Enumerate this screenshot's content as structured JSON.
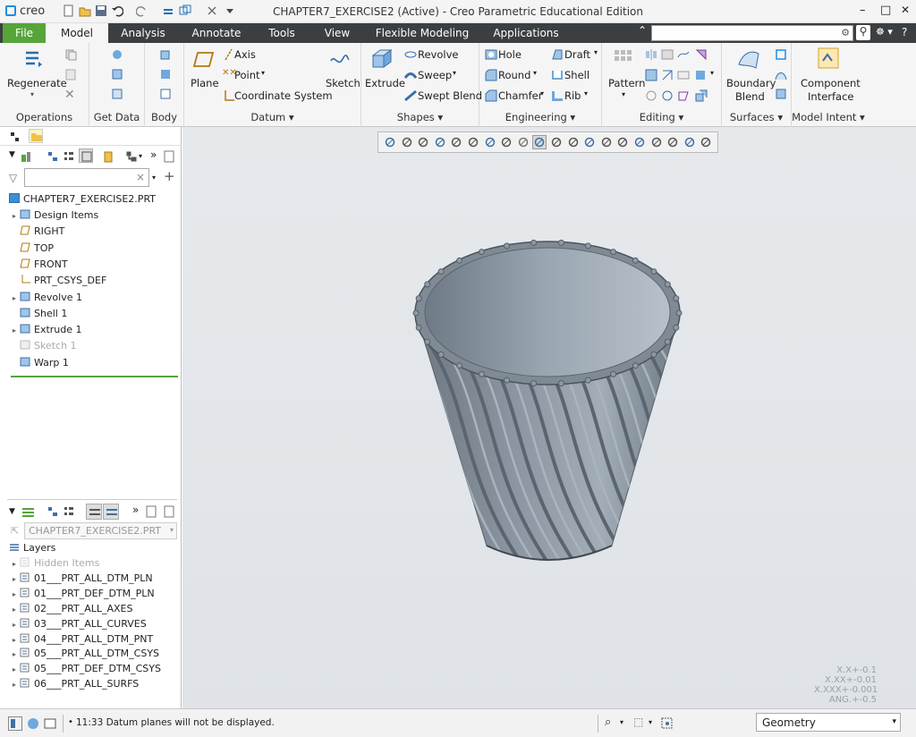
{
  "window": {
    "title": "CHAPTER7_EXERCISE2 (Active) - Creo Parametric Educational Edition",
    "logo": "creo",
    "controls": [
      "–",
      "□",
      "✕"
    ]
  },
  "tabs": [
    "File",
    "Model",
    "Analysis",
    "Annotate",
    "Tools",
    "View",
    "Flexible Modeling",
    "Applications"
  ],
  "active_tab": "Model",
  "ribbon": {
    "operations": {
      "regenerate": "Regenerate",
      "label": "Operations"
    },
    "get_data": {
      "label": "Get Data"
    },
    "body": {
      "label": "Body"
    },
    "datum": {
      "plane": "Plane",
      "axis": "Axis",
      "point": "Point",
      "csys": "Coordinate System",
      "sketch": "Sketch",
      "label": "Datum"
    },
    "shapes": {
      "extrude": "Extrude",
      "revolve": "Revolve",
      "sweep": "Sweep",
      "swept_blend": "Swept Blend",
      "label": "Shapes"
    },
    "engineering": {
      "hole": "Hole",
      "draft": "Draft",
      "round": "Round",
      "shell": "Shell",
      "chamfer": "Chamfer",
      "rib": "Rib",
      "label": "Engineering"
    },
    "editing": {
      "pattern": "Pattern",
      "label": "Editing"
    },
    "surfaces": {
      "boundary1": "Boundary",
      "boundary2": "Blend",
      "label": "Surfaces"
    },
    "model_intent": {
      "ci1": "Component",
      "ci2": "Interface",
      "label": "Model Intent"
    }
  },
  "model_tree": {
    "root": "CHAPTER7_EXERCISE2.PRT",
    "items": [
      {
        "label": "Design Items",
        "expandable": true,
        "disabled": false
      },
      {
        "label": "RIGHT",
        "expandable": false,
        "disabled": false
      },
      {
        "label": "TOP",
        "expandable": false,
        "disabled": false
      },
      {
        "label": "FRONT",
        "expandable": false,
        "disabled": false
      },
      {
        "label": "PRT_CSYS_DEF",
        "expandable": false,
        "disabled": false
      },
      {
        "label": "Revolve 1",
        "expandable": true,
        "disabled": false
      },
      {
        "label": "Shell 1",
        "expandable": false,
        "disabled": false
      },
      {
        "label": "Extrude 1",
        "expandable": true,
        "disabled": false
      },
      {
        "label": "Sketch 1",
        "expandable": false,
        "disabled": true
      },
      {
        "label": "Warp 1",
        "expandable": false,
        "disabled": false
      }
    ]
  },
  "layer_tree": {
    "model_select": "CHAPTER7_EXERCISE2.PRT",
    "header": "Layers",
    "items": [
      {
        "label": "Hidden Items",
        "disabled": true
      },
      {
        "label": "01___PRT_ALL_DTM_PLN",
        "disabled": false
      },
      {
        "label": "01___PRT_DEF_DTM_PLN",
        "disabled": false
      },
      {
        "label": "02___PRT_ALL_AXES",
        "disabled": false
      },
      {
        "label": "03___PRT_ALL_CURVES",
        "disabled": false
      },
      {
        "label": "04___PRT_ALL_DTM_PNT",
        "disabled": false
      },
      {
        "label": "05___PRT_ALL_DTM_CSYS",
        "disabled": false
      },
      {
        "label": "05___PRT_DEF_DTM_CSYS",
        "disabled": false
      },
      {
        "label": "06___PRT_ALL_SURFS",
        "disabled": false
      }
    ]
  },
  "tolerances": [
    "X.X+-0.1",
    "X.XX+-0.01",
    "X.XXX+-0.001",
    "ANG.+-0.5"
  ],
  "status": {
    "message": "11:33 Datum planes will not be displayed.",
    "filter": "Geometry"
  },
  "colors": {
    "tab_bar": "#3c3f42",
    "file_tab": "#56a43a",
    "model": "#7e8a96"
  }
}
